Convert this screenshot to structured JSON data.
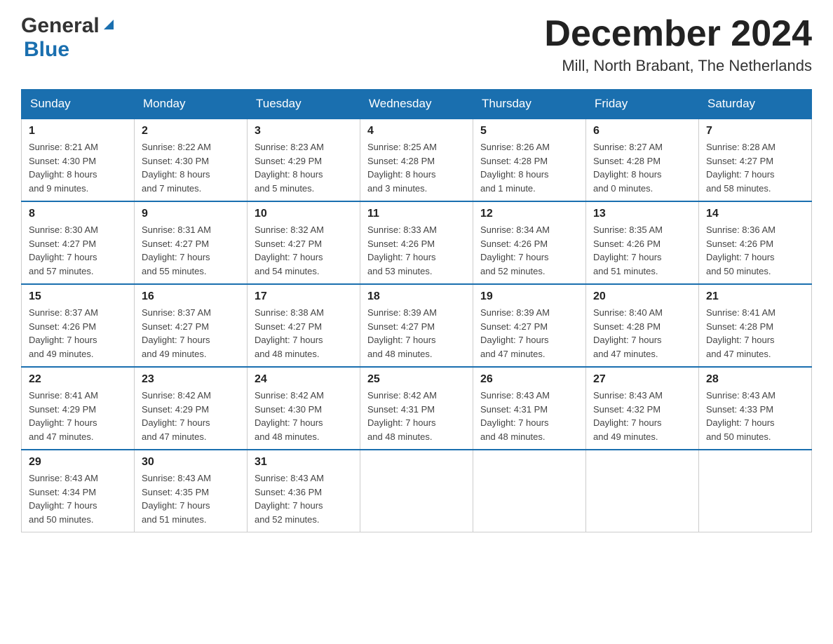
{
  "header": {
    "logo_general": "General",
    "logo_blue": "Blue",
    "month_title": "December 2024",
    "location": "Mill, North Brabant, The Netherlands"
  },
  "weekdays": [
    "Sunday",
    "Monday",
    "Tuesday",
    "Wednesday",
    "Thursday",
    "Friday",
    "Saturday"
  ],
  "weeks": [
    [
      {
        "day": "1",
        "sunrise": "8:21 AM",
        "sunset": "4:30 PM",
        "daylight": "8 hours and 9 minutes."
      },
      {
        "day": "2",
        "sunrise": "8:22 AM",
        "sunset": "4:30 PM",
        "daylight": "8 hours and 7 minutes."
      },
      {
        "day": "3",
        "sunrise": "8:23 AM",
        "sunset": "4:29 PM",
        "daylight": "8 hours and 5 minutes."
      },
      {
        "day": "4",
        "sunrise": "8:25 AM",
        "sunset": "4:28 PM",
        "daylight": "8 hours and 3 minutes."
      },
      {
        "day": "5",
        "sunrise": "8:26 AM",
        "sunset": "4:28 PM",
        "daylight": "8 hours and 1 minute."
      },
      {
        "day": "6",
        "sunrise": "8:27 AM",
        "sunset": "4:28 PM",
        "daylight": "8 hours and 0 minutes."
      },
      {
        "day": "7",
        "sunrise": "8:28 AM",
        "sunset": "4:27 PM",
        "daylight": "7 hours and 58 minutes."
      }
    ],
    [
      {
        "day": "8",
        "sunrise": "8:30 AM",
        "sunset": "4:27 PM",
        "daylight": "7 hours and 57 minutes."
      },
      {
        "day": "9",
        "sunrise": "8:31 AM",
        "sunset": "4:27 PM",
        "daylight": "7 hours and 55 minutes."
      },
      {
        "day": "10",
        "sunrise": "8:32 AM",
        "sunset": "4:27 PM",
        "daylight": "7 hours and 54 minutes."
      },
      {
        "day": "11",
        "sunrise": "8:33 AM",
        "sunset": "4:26 PM",
        "daylight": "7 hours and 53 minutes."
      },
      {
        "day": "12",
        "sunrise": "8:34 AM",
        "sunset": "4:26 PM",
        "daylight": "7 hours and 52 minutes."
      },
      {
        "day": "13",
        "sunrise": "8:35 AM",
        "sunset": "4:26 PM",
        "daylight": "7 hours and 51 minutes."
      },
      {
        "day": "14",
        "sunrise": "8:36 AM",
        "sunset": "4:26 PM",
        "daylight": "7 hours and 50 minutes."
      }
    ],
    [
      {
        "day": "15",
        "sunrise": "8:37 AM",
        "sunset": "4:26 PM",
        "daylight": "7 hours and 49 minutes."
      },
      {
        "day": "16",
        "sunrise": "8:37 AM",
        "sunset": "4:27 PM",
        "daylight": "7 hours and 49 minutes."
      },
      {
        "day": "17",
        "sunrise": "8:38 AM",
        "sunset": "4:27 PM",
        "daylight": "7 hours and 48 minutes."
      },
      {
        "day": "18",
        "sunrise": "8:39 AM",
        "sunset": "4:27 PM",
        "daylight": "7 hours and 48 minutes."
      },
      {
        "day": "19",
        "sunrise": "8:39 AM",
        "sunset": "4:27 PM",
        "daylight": "7 hours and 47 minutes."
      },
      {
        "day": "20",
        "sunrise": "8:40 AM",
        "sunset": "4:28 PM",
        "daylight": "7 hours and 47 minutes."
      },
      {
        "day": "21",
        "sunrise": "8:41 AM",
        "sunset": "4:28 PM",
        "daylight": "7 hours and 47 minutes."
      }
    ],
    [
      {
        "day": "22",
        "sunrise": "8:41 AM",
        "sunset": "4:29 PM",
        "daylight": "7 hours and 47 minutes."
      },
      {
        "day": "23",
        "sunrise": "8:42 AM",
        "sunset": "4:29 PM",
        "daylight": "7 hours and 47 minutes."
      },
      {
        "day": "24",
        "sunrise": "8:42 AM",
        "sunset": "4:30 PM",
        "daylight": "7 hours and 48 minutes."
      },
      {
        "day": "25",
        "sunrise": "8:42 AM",
        "sunset": "4:31 PM",
        "daylight": "7 hours and 48 minutes."
      },
      {
        "day": "26",
        "sunrise": "8:43 AM",
        "sunset": "4:31 PM",
        "daylight": "7 hours and 48 minutes."
      },
      {
        "day": "27",
        "sunrise": "8:43 AM",
        "sunset": "4:32 PM",
        "daylight": "7 hours and 49 minutes."
      },
      {
        "day": "28",
        "sunrise": "8:43 AM",
        "sunset": "4:33 PM",
        "daylight": "7 hours and 50 minutes."
      }
    ],
    [
      {
        "day": "29",
        "sunrise": "8:43 AM",
        "sunset": "4:34 PM",
        "daylight": "7 hours and 50 minutes."
      },
      {
        "day": "30",
        "sunrise": "8:43 AM",
        "sunset": "4:35 PM",
        "daylight": "7 hours and 51 minutes."
      },
      {
        "day": "31",
        "sunrise": "8:43 AM",
        "sunset": "4:36 PM",
        "daylight": "7 hours and 52 minutes."
      },
      null,
      null,
      null,
      null
    ]
  ],
  "labels": {
    "sunrise": "Sunrise:",
    "sunset": "Sunset:",
    "daylight": "Daylight:"
  }
}
